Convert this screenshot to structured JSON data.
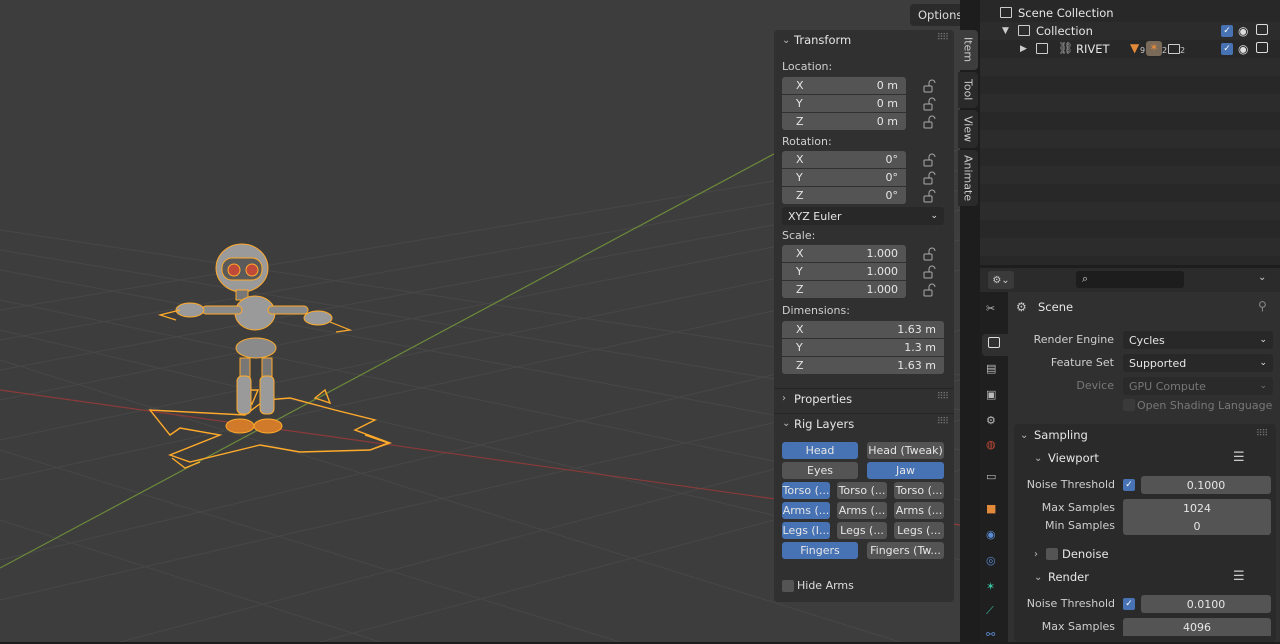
{
  "viewport": {
    "options_label": "Options"
  },
  "npanel": {
    "transform": {
      "title": "Transform",
      "location_label": "Location:",
      "location": [
        {
          "axis": "X",
          "value": "0 m"
        },
        {
          "axis": "Y",
          "value": "0 m"
        },
        {
          "axis": "Z",
          "value": "0 m"
        }
      ],
      "rotation_label": "Rotation:",
      "rotation": [
        {
          "axis": "X",
          "value": "0°"
        },
        {
          "axis": "Y",
          "value": "0°"
        },
        {
          "axis": "Z",
          "value": "0°"
        }
      ],
      "rotation_mode": "XYZ Euler",
      "scale_label": "Scale:",
      "scale": [
        {
          "axis": "X",
          "value": "1.000"
        },
        {
          "axis": "Y",
          "value": "1.000"
        },
        {
          "axis": "Z",
          "value": "1.000"
        }
      ],
      "dimensions_label": "Dimensions:",
      "dimensions": [
        {
          "axis": "X",
          "value": "1.63 m"
        },
        {
          "axis": "Y",
          "value": "1.3 m"
        },
        {
          "axis": "Z",
          "value": "1.63 m"
        }
      ]
    },
    "properties_title": "Properties",
    "rig_layers": {
      "title": "Rig Layers",
      "rows": [
        [
          {
            "label": "Head",
            "on": true
          },
          {
            "label": "Head (Tweak)",
            "on": false
          }
        ],
        [
          {
            "label": "Eyes",
            "on": false
          },
          {
            "label": "Jaw",
            "on": true
          }
        ],
        [
          {
            "label": "Torso (...",
            "on": true
          },
          {
            "label": "Torso (...",
            "on": false
          },
          {
            "label": "Torso (...",
            "on": false
          }
        ],
        [
          {
            "label": "Arms (...",
            "on": true
          },
          {
            "label": "Arms (...",
            "on": false
          },
          {
            "label": "Arms (...",
            "on": false
          }
        ],
        [
          {
            "label": "Legs (I...",
            "on": true
          },
          {
            "label": "Legs (...",
            "on": false
          },
          {
            "label": "Legs (...",
            "on": false
          }
        ],
        [
          {
            "label": "Fingers",
            "on": true
          },
          {
            "label": "Fingers (Tw...",
            "on": false
          }
        ]
      ],
      "hide_arms_label": "Hide Arms"
    }
  },
  "tabs": [
    "Item",
    "Tool",
    "View",
    "Animate"
  ],
  "outliner": {
    "scene_collection": "Scene Collection",
    "collection": "Collection",
    "object": "RIVET",
    "badge1": "9",
    "badge2": "2",
    "badge3": "2"
  },
  "properties": {
    "scene_name": "Scene",
    "render_engine_label": "Render Engine",
    "render_engine": "Cycles",
    "feature_set_label": "Feature Set",
    "feature_set": "Supported",
    "device_label": "Device",
    "device": "GPU Compute",
    "osl_label": "Open Shading Language",
    "sampling_title": "Sampling",
    "viewport_title": "Viewport",
    "vp_noise_label": "Noise Threshold",
    "vp_noise": "0.1000",
    "vp_max_label": "Max Samples",
    "vp_max": "1024",
    "vp_min_label": "Min Samples",
    "vp_min": "0",
    "denoise_label": "Denoise",
    "render_title": "Render",
    "r_noise_label": "Noise Threshold",
    "r_noise": "0.0100",
    "r_max_label": "Max Samples",
    "r_max": "4096"
  },
  "colors": {
    "accent": "#4772b3",
    "selection_orange": "#ffaa2a",
    "x_axis": "#8b3a3a",
    "y_axis": "#6c8a3a"
  }
}
